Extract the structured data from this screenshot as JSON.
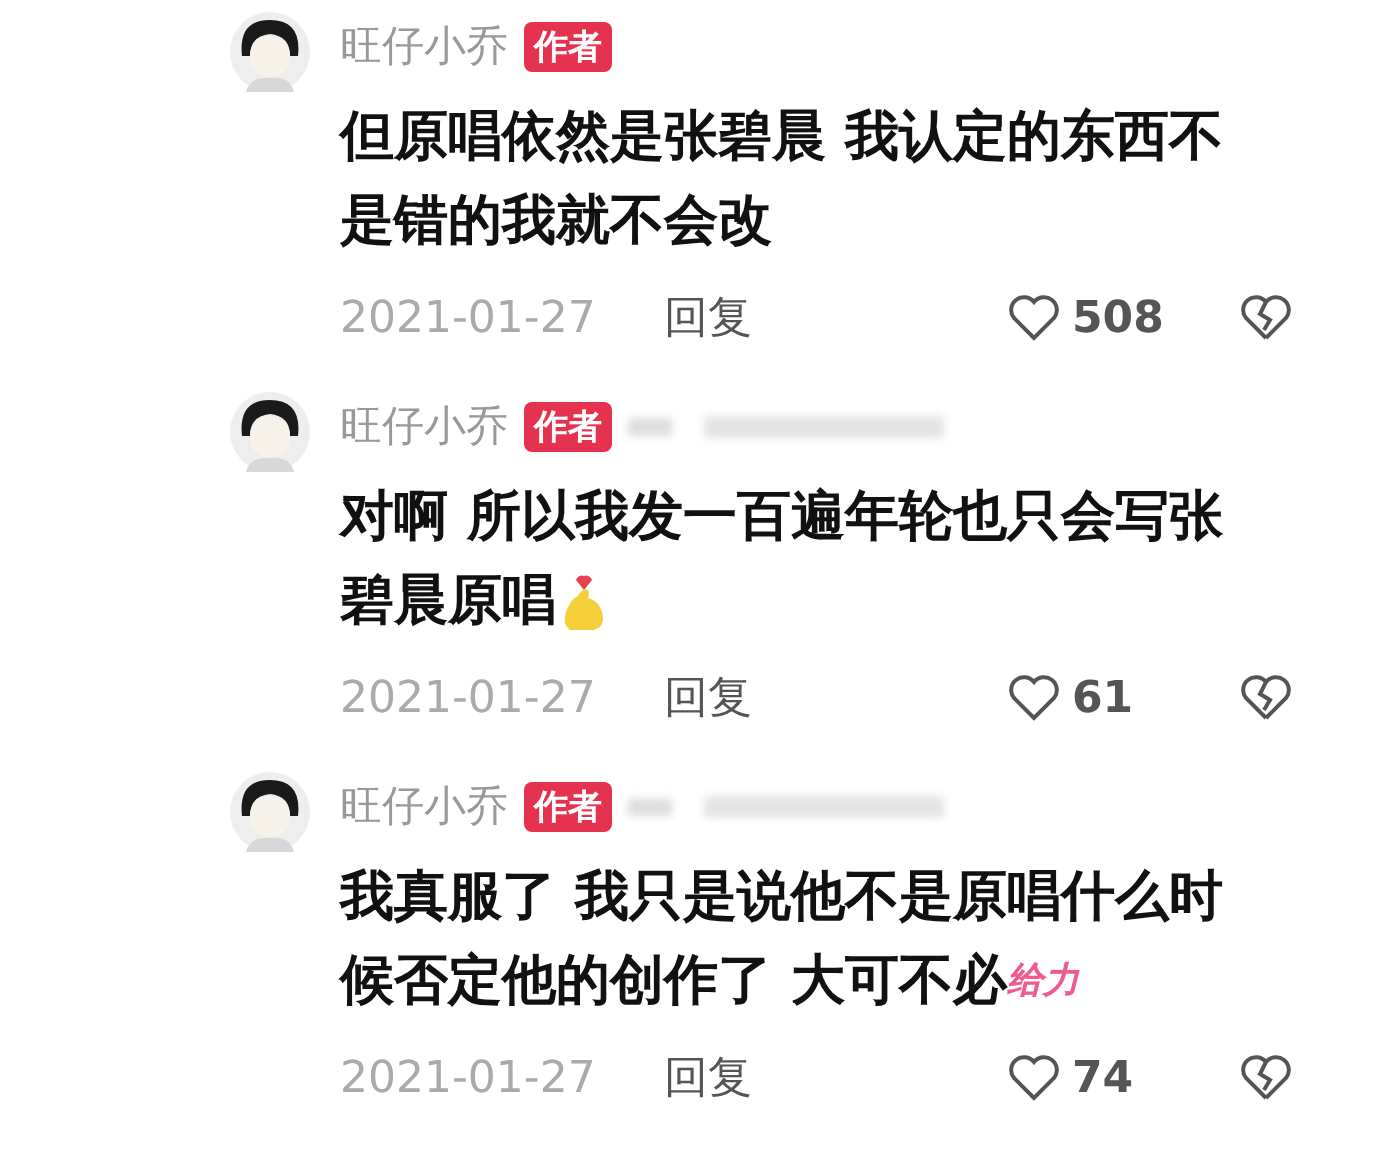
{
  "comments": [
    {
      "author": "旺仔小乔",
      "badge": "作者",
      "reply_to_blurred": false,
      "lines": [
        "但原唱依然是张碧晨 我认定的东西不",
        "是错的我就不会改"
      ],
      "date": "2021-01-27",
      "reply": "回复",
      "likes": "508"
    },
    {
      "author": "旺仔小乔",
      "badge": "作者",
      "reply_to_blurred": true,
      "lines": [
        "对啊 所以我发一百遍年轮也只会写张",
        "碧晨原唱"
      ],
      "trailing": {
        "kind": "emoji"
      },
      "date": "2021-01-27",
      "reply": "回复",
      "likes": "61"
    },
    {
      "author": "旺仔小乔",
      "badge": "作者",
      "reply_to_blurred": true,
      "lines": [
        "我真服了 我只是说他不是原唱什么时",
        "候否定他的创作了 大可不必"
      ],
      "trailing": {
        "kind": "sticker",
        "text": "给力"
      },
      "date": "2021-01-27",
      "reply": "回复",
      "likes": "74"
    }
  ]
}
